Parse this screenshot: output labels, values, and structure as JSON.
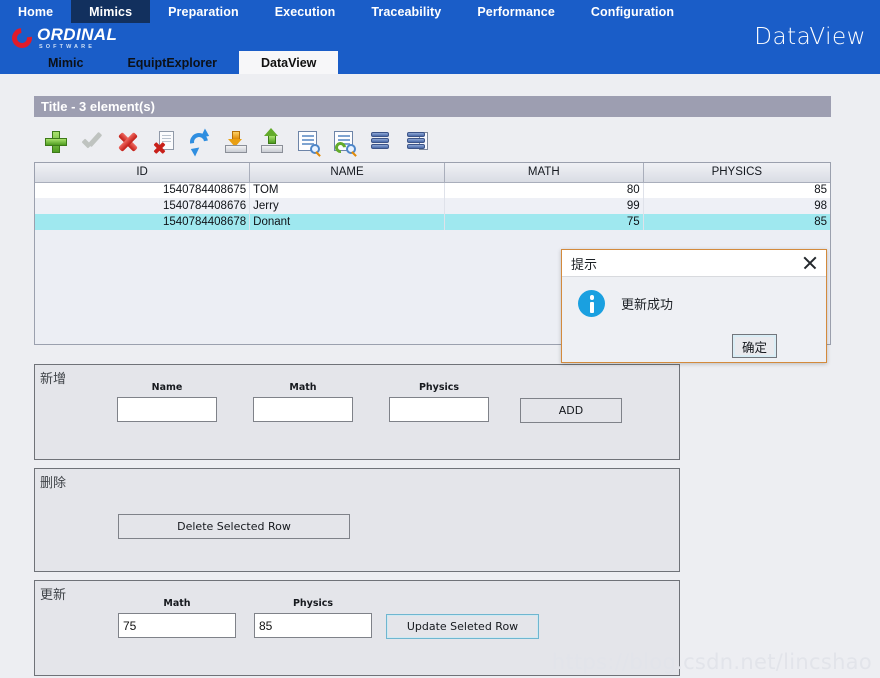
{
  "colors": {
    "banner_blue": "#1a5dc8",
    "nav_active_navy": "#12305e",
    "panel_grey": "#edeef2",
    "title_bar_grey": "#9d9eb1",
    "row_selected_cyan": "#9fe8ef",
    "dialog_border_orange": "#d38a3c",
    "info_blue": "#1aa0e0"
  },
  "header": {
    "nav_items": [
      {
        "label": "Home",
        "active": false
      },
      {
        "label": "Mimics",
        "active": true
      },
      {
        "label": "Preparation",
        "active": false
      },
      {
        "label": "Execution",
        "active": false
      },
      {
        "label": "Traceability",
        "active": false
      },
      {
        "label": "Performance",
        "active": false
      },
      {
        "label": "Configuration",
        "active": false
      }
    ],
    "brand": {
      "name": "ORDINAL",
      "subtitle": "SOFTWARE",
      "icon": "ordinal-ring-logo"
    },
    "banner_title": "DataView",
    "subtabs": [
      {
        "label": "Mimic",
        "active": false
      },
      {
        "label": "EquiptExplorer",
        "active": false
      },
      {
        "label": "DataView",
        "active": true
      }
    ]
  },
  "data_panel": {
    "title": "Title - 3 element(s)",
    "toolbar": [
      {
        "name": "add-icon",
        "icon": "green-plus"
      },
      {
        "name": "confirm-icon",
        "icon": "grey-check"
      },
      {
        "name": "delete-icon",
        "icon": "red-x"
      },
      {
        "name": "delete-document-icon",
        "icon": "page-with-red-x"
      },
      {
        "name": "refresh-icon",
        "icon": "blue-circular-arrows"
      },
      {
        "name": "import-icon",
        "icon": "orange-down-arrow-tray"
      },
      {
        "name": "export-icon",
        "icon": "green-up-arrow-tray"
      },
      {
        "name": "search-document-icon",
        "icon": "document-magnifier"
      },
      {
        "name": "refresh-query-icon",
        "icon": "document-magnifier-refresh"
      },
      {
        "name": "database-icon",
        "icon": "database-stack"
      },
      {
        "name": "database-copy-icon",
        "icon": "database-stack-page"
      }
    ]
  },
  "table": {
    "columns": [
      "ID",
      "NAME",
      "MATH",
      "PHYSICS"
    ],
    "rows": [
      {
        "id": "1540784408675",
        "name": "TOM",
        "math": "80",
        "physics": "85",
        "selected": false
      },
      {
        "id": "1540784408676",
        "name": "Jerry",
        "math": "99",
        "physics": "98",
        "selected": false
      },
      {
        "id": "1540784408678",
        "name": "Donant",
        "math": "75",
        "physics": "85",
        "selected": true
      }
    ]
  },
  "add_panel": {
    "caption": "新增",
    "fields": [
      {
        "label": "Name",
        "value": "",
        "placeholder": ""
      },
      {
        "label": "Math",
        "value": "",
        "placeholder": ""
      },
      {
        "label": "Physics",
        "value": "",
        "placeholder": ""
      }
    ],
    "button": "ADD"
  },
  "delete_panel": {
    "caption": "删除",
    "button": "Delete Selected Row"
  },
  "update_panel": {
    "caption": "更新",
    "fields": [
      {
        "label": "Math",
        "value": "75",
        "placeholder": ""
      },
      {
        "label": "Physics",
        "value": "85",
        "placeholder": ""
      }
    ],
    "button": "Update Seleted Row"
  },
  "dialog": {
    "title": "提示",
    "message": "更新成功",
    "ok_button": "确定",
    "close_icon": "close-icon",
    "info_icon": "info-circle-icon"
  },
  "watermark": "https://blog.csdn.net/lincshao"
}
